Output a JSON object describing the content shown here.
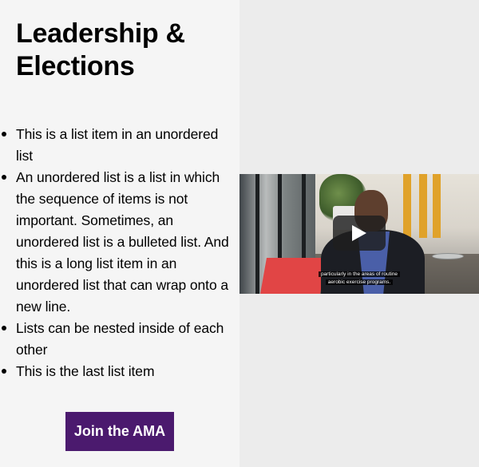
{
  "heading": "Leadership & Elections",
  "list_items": [
    "This is a list item in an unordered list",
    "An unordered list is a list in which the sequence of items is not important. Sometimes, an unordered list is a bulleted list. And this is a long list item in an unordered list that can wrap onto a new line.",
    "Lists can be nested inside of each other",
    "This is the last list item"
  ],
  "cta": {
    "label": "Join the AMA"
  },
  "video": {
    "caption_line_1": "particularly in the areas of routine",
    "caption_line_2": "aerobic exercise programs.",
    "play_icon": "play-icon"
  },
  "colors": {
    "left_panel_bg": "#f5f5f5",
    "right_panel_bg": "#ececec",
    "cta_bg": "#4b1a6e",
    "cta_text": "#ffffff"
  }
}
